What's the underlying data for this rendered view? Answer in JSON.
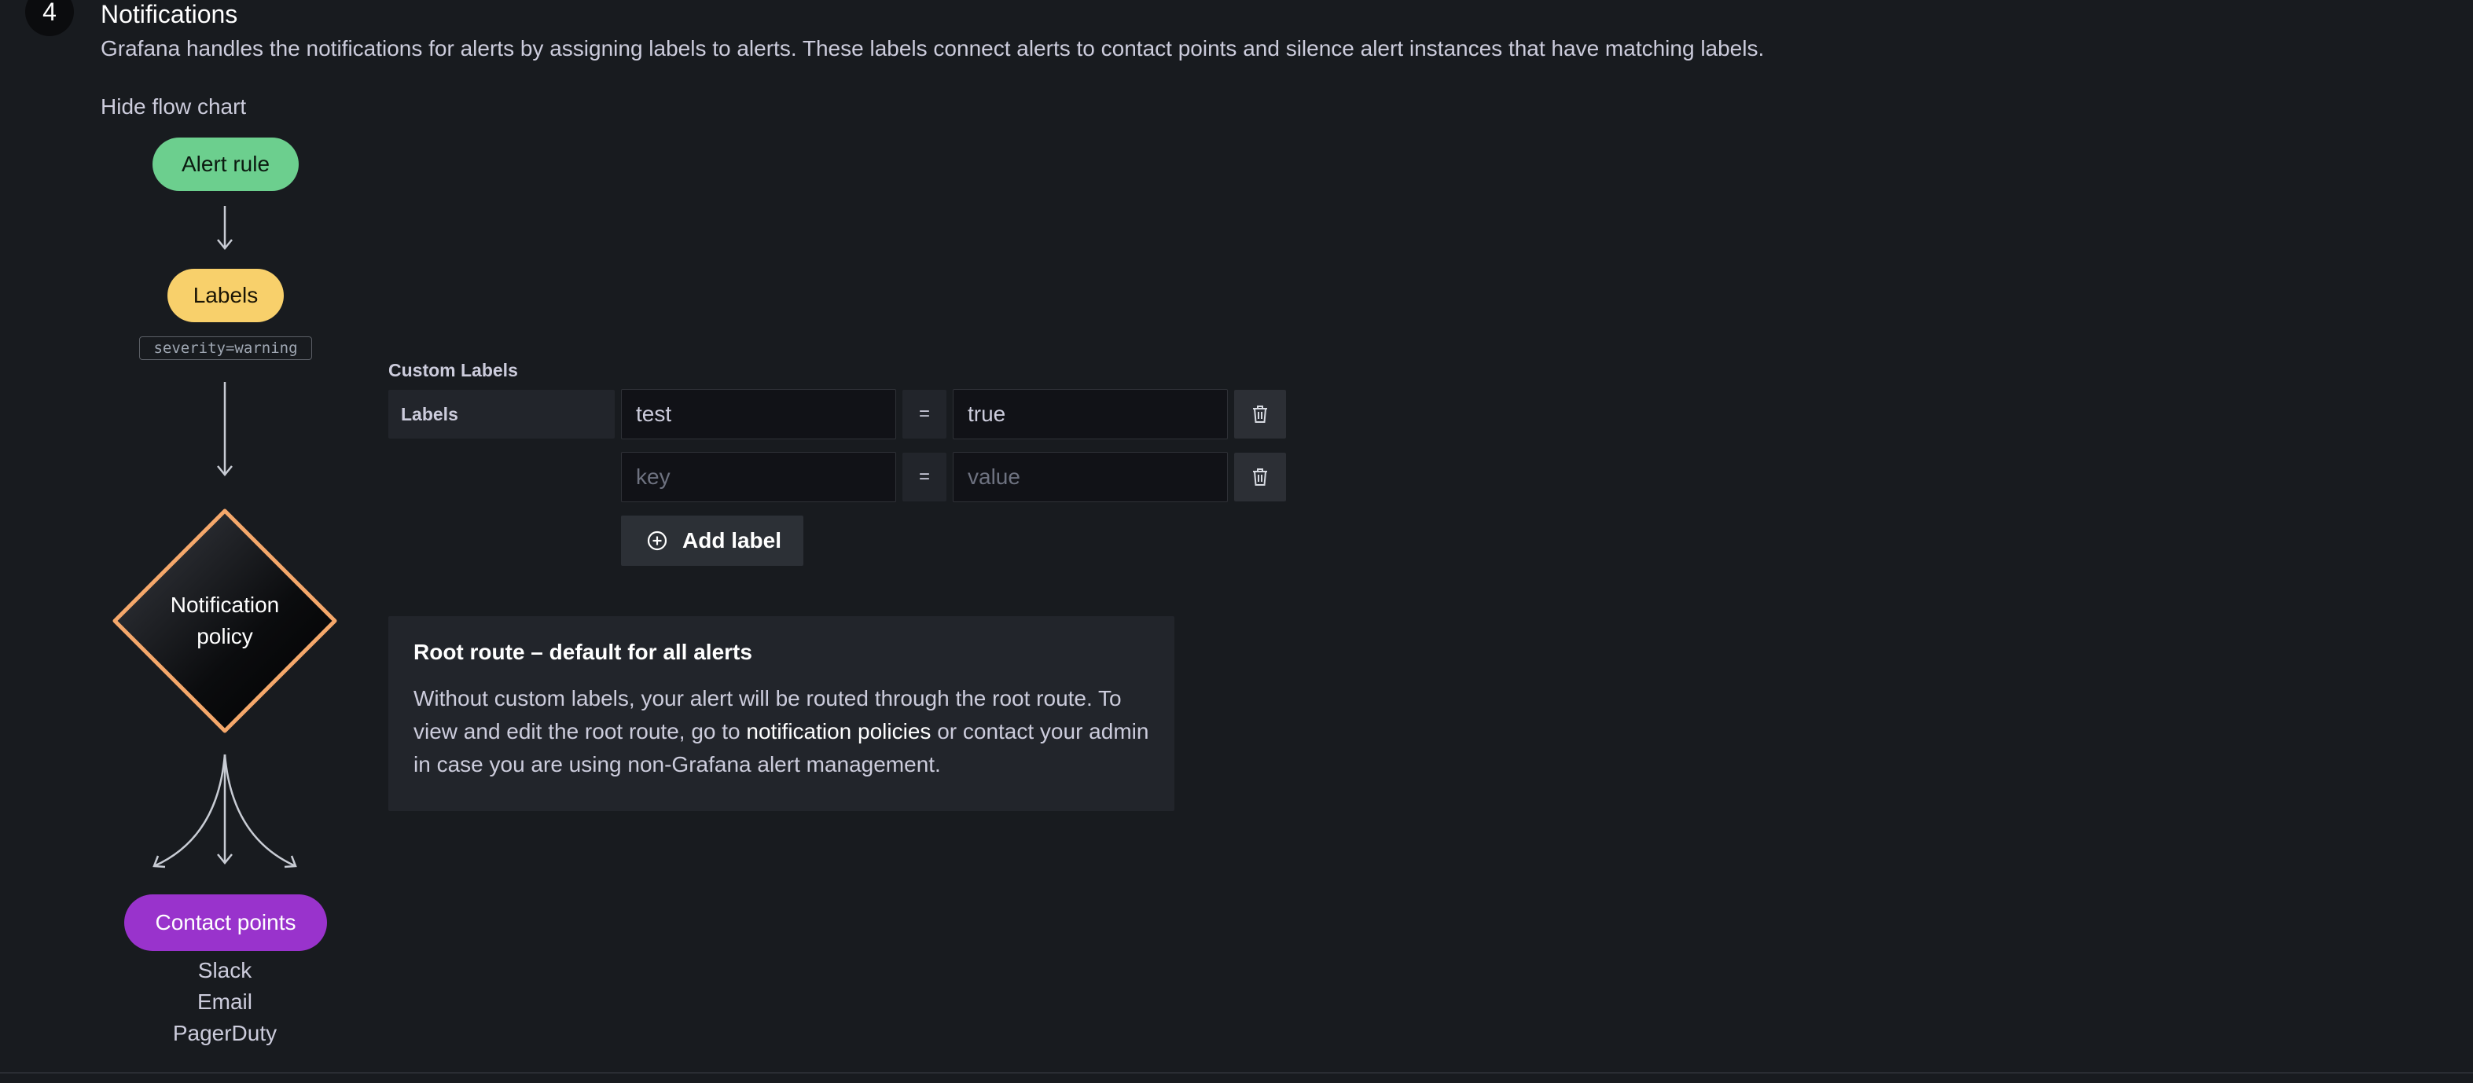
{
  "section": {
    "step_number": "4",
    "title": "Notifications",
    "description": "Grafana handles the notifications for alerts by assigning labels to alerts. These labels connect alerts to contact points and silence alert instances that have matching labels.",
    "toggle_flow_label": "Hide flow chart"
  },
  "flow": {
    "alert_rule": "Alert rule",
    "labels": "Labels",
    "label_example": "severity=warning",
    "policy_line1": "Notification",
    "policy_line2": "policy",
    "contact_points": "Contact points",
    "contact_list": [
      "Slack",
      "Email",
      "PagerDuty"
    ],
    "colors": {
      "alert_rule": "#6ccf8e",
      "labels": "#f8d06b",
      "policy_border": "#f5a86b",
      "contact_points": "#9933cc"
    }
  },
  "custom_labels": {
    "title": "Custom Labels",
    "row_header": "Labels",
    "equals": "=",
    "rows": [
      {
        "key": "test",
        "value": "true",
        "key_placeholder": "key",
        "value_placeholder": "value"
      },
      {
        "key": "",
        "value": "",
        "key_placeholder": "key",
        "value_placeholder": "value"
      }
    ],
    "add_label": "Add label",
    "delete_icon": "trash-icon",
    "add_icon": "plus-circle-icon"
  },
  "root_route": {
    "title": "Root route – default for all alerts",
    "body_before": "Without custom labels, your alert will be routed through the root route. To view and edit the root route, go to ",
    "link": "notification policies",
    "body_after": " or contact your admin in case you are using non-Grafana alert management."
  }
}
